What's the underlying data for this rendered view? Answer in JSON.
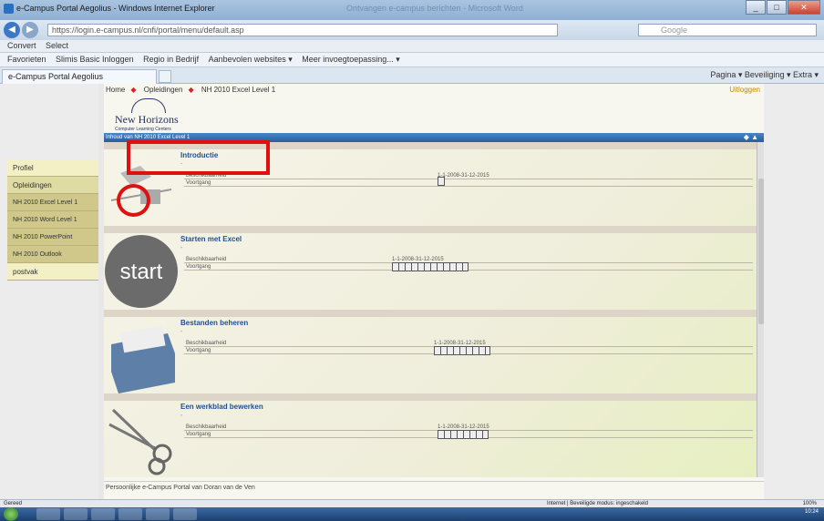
{
  "window": {
    "title": "e-Campus Portal Aegolius - Windows Internet Explorer",
    "ghost_title": "Ontvangen e-campus berichten - Microsoft Word",
    "btn_min": "_",
    "btn_max": "□",
    "btn_close": "✕"
  },
  "address": {
    "url": "https://login.e-campus.nl/cnfi/portal/menu/default.asp",
    "search_placeholder": "Google"
  },
  "cmdbar": {
    "items": [
      "Convert",
      "Select"
    ]
  },
  "favbar": {
    "items": [
      "Favorieten",
      "Slimis Basic Inloggen",
      "Regio in Bedrijf",
      "Aanbevolen websites ▾",
      "Meer invoegtoepassing... ▾"
    ]
  },
  "tab": {
    "label": "e-Campus Portal Aegolius",
    "tools": "Pagina ▾  Beveiliging ▾  Extra ▾"
  },
  "breadcrumb": {
    "home": "Home",
    "opleidingen": "Opleidingen",
    "course": "NH 2010 Excel Level 1",
    "sep": "◆"
  },
  "logout": "Uitloggen",
  "logo": {
    "name": "New Horizons",
    "sub": "Computer Learning Centers"
  },
  "band": "Inhoud van NH 2010 Excel Level 1",
  "menu": [
    {
      "label": "Profiel",
      "style": "light"
    },
    {
      "label": "Opleidingen",
      "style": "normal"
    },
    {
      "label": "NH 2010 Excel Level 1",
      "style": "dark"
    },
    {
      "label": "NH 2010 Word Level 1",
      "style": "dark"
    },
    {
      "label": "NH 2010 PowerPoint",
      "style": "dark"
    },
    {
      "label": "NH 2010 Outlook",
      "style": "dark"
    },
    {
      "label": "postvak",
      "style": "light"
    }
  ],
  "courses": [
    {
      "title": "Introductie",
      "dot": "-",
      "label1": "Beschikbaarheid",
      "label2": "Voortgang",
      "period": "1-1-2008-31-12-2015"
    },
    {
      "title": "Starten met Excel",
      "dot": "-",
      "label1": "Beschikbaarheid",
      "label2": "Voortgang",
      "period": "1-1-2008-31-12-2015",
      "thumb": "start"
    },
    {
      "title": "Bestanden beheren",
      "dot": "-",
      "label1": "Beschikbaarheid",
      "label2": "Voortgang",
      "period": "1-1-2008-31-12-2015"
    },
    {
      "title": "Een werkblad bewerken",
      "dot": "-",
      "label1": "Beschikbaarheid",
      "label2": "Voortgang",
      "period": "1-1-2008-31-12-2015"
    }
  ],
  "footer": "Persoonlijke e-Campus Portal van Doran van de Ven",
  "status": {
    "left": "Gereed",
    "middle": "Internet | Beveiligde modus: ingeschakeld",
    "zoom": "100%"
  },
  "clock": "10:24",
  "colors": {
    "accent": "#275e9c",
    "highlight": "#e01010",
    "menu": "#dfdca3",
    "link": "#1f4f94"
  }
}
